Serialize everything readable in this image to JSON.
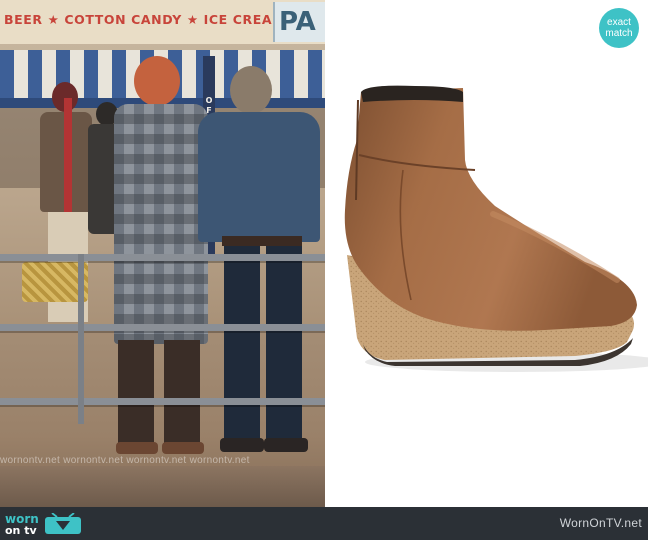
{
  "scene": {
    "sign_text": "BEER ★ COTTON CANDY ★ ICE CREAM",
    "sign_partial": "PA",
    "pole_text": "OFTS",
    "watermark_repeat": "wornontv.net  wornontv.net  wornontv.net  wornontv.net"
  },
  "badge": {
    "line1": "exact",
    "line2": "match"
  },
  "footer": {
    "logo_worn": "worn",
    "logo_on": "on tv",
    "site": "WornOnTV.net",
    "icon": "tv-icon"
  },
  "colors": {
    "accent_teal": "#3ec2c6",
    "footer_bg": "#2b3036",
    "boot_leather": "#9a6440",
    "boot_cork": "#c9a57a"
  }
}
